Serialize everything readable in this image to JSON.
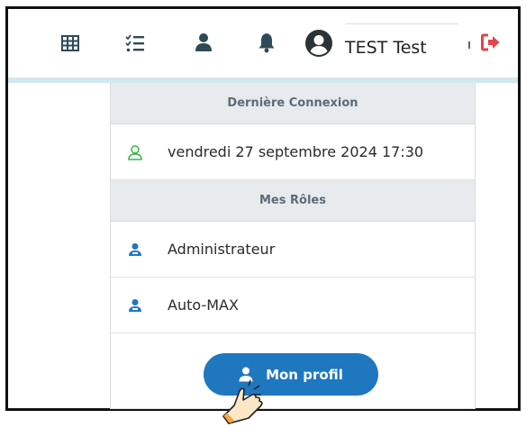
{
  "header": {
    "user_name": "TEST Test",
    "icons": [
      "grid-icon",
      "tasks-icon",
      "user-icon",
      "bell-icon",
      "account-circle-icon",
      "logout-icon"
    ],
    "colors": {
      "icon": "#2f4a57",
      "logout": "#e8424b",
      "accent_line": "#cfe9ee"
    }
  },
  "dropdown": {
    "last_login_header": "Dernière Connexion",
    "last_login_value": "vendredi 27 septembre 2024 17:30",
    "roles_header": "Mes Rôles",
    "roles": [
      "Administrateur",
      "Auto-MAX"
    ],
    "profile_button": "Mon profil",
    "colors": {
      "button": "#1f77c0",
      "header_bg": "#e7ebee",
      "login_icon": "#3bb54a",
      "role_icon": "#1f77c0"
    }
  }
}
